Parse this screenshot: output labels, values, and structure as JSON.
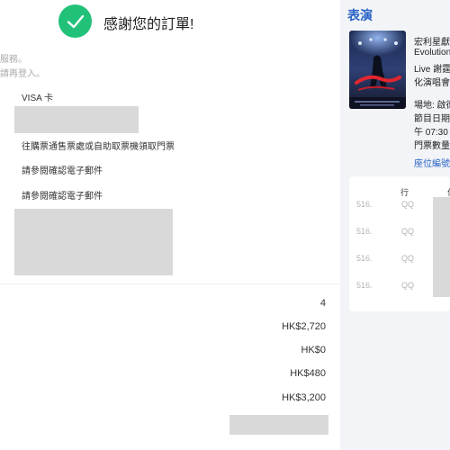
{
  "confirmation": {
    "title": "感謝您的訂單!",
    "note_line1": "服務。",
    "note_line2": "請再登入。"
  },
  "order_info": {
    "payment_method": "VISA 卡",
    "pickup_method": "往購票通售票處或自助取票機領取門票",
    "email_ref1": "請參閱確認電子郵件",
    "email_ref2": "請參閱確認電子郵件"
  },
  "summary": {
    "ticket_qty": "4",
    "subtotal": "HK$2,720",
    "fee1": "HK$0",
    "fee2": "HK$480",
    "total": "HK$3,200"
  },
  "performance": {
    "section_title": "表演",
    "poster_icon": "concert-poster-image",
    "event_name": [
      "宏利星獻",
      "Evolution",
      "Live 謝霆",
      "化演唱會"
    ],
    "details": [
      "場地: 啟德",
      "節目日期",
      "午 07:30",
      "門票數量"
    ],
    "seat_link": "座位編號"
  },
  "seat_table": {
    "headers": [
      "行",
      "位"
    ],
    "rows": [
      {
        "section": "516.",
        "row": "QQ"
      },
      {
        "section": "516.",
        "row": "QQ"
      },
      {
        "section": "516.",
        "row": "QQ"
      },
      {
        "section": "516.",
        "row": "QQ"
      }
    ]
  },
  "colors": {
    "success_green": "#22c17a",
    "link_blue": "#2962c6",
    "redacted_gray": "#d9d9d9"
  }
}
